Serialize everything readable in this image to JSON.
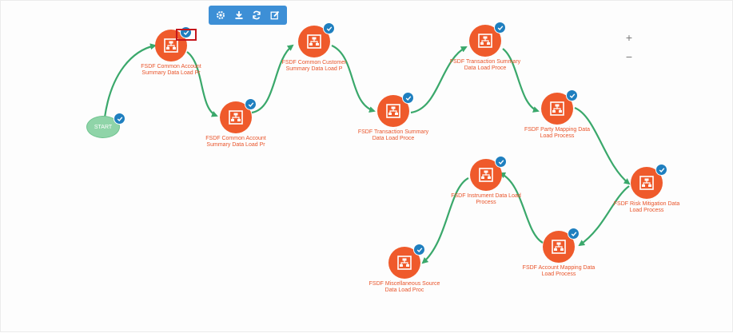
{
  "toolbar": {
    "buttons": [
      {
        "icon": "gear-icon"
      },
      {
        "icon": "download-icon"
      },
      {
        "icon": "refresh-icon"
      },
      {
        "icon": "edit-icon"
      }
    ]
  },
  "zoom": {
    "in_label": "+",
    "out_label": "−"
  },
  "start": {
    "label": "START"
  },
  "colors": {
    "node_fill": "#ef5a2b",
    "label_text": "#e9542a",
    "edge": "#3aa86b",
    "check": "#1f7fbf",
    "start_fill": "#8fd4a8",
    "toolbar": "#3d8fd6",
    "selection": "#c4161c"
  },
  "nodes": [
    {
      "id": "n1",
      "label": "FSDF Common Account Summary Data Load Pr"
    },
    {
      "id": "n2",
      "label": "FSDF Common Account Summary Data Load Pr"
    },
    {
      "id": "n3",
      "label": "FSDF Common Customer Summary Data Load P"
    },
    {
      "id": "n4",
      "label": "FSDF Transaction Summary Data Load Proce"
    },
    {
      "id": "n5",
      "label": "FSDF Transaction Summary Data Load Proce"
    },
    {
      "id": "n6",
      "label": "FSDF Party Mapping Data Load Process"
    },
    {
      "id": "n7",
      "label": "FSDF Risk Mitigation Data Load Process"
    },
    {
      "id": "n8",
      "label": "FSDF Account Mapping Data Load Process"
    },
    {
      "id": "n9",
      "label": "FSDF Instrument Data Load Process"
    },
    {
      "id": "n10",
      "label": "FSDF Miscellaneous Source Data Load Proc"
    }
  ]
}
